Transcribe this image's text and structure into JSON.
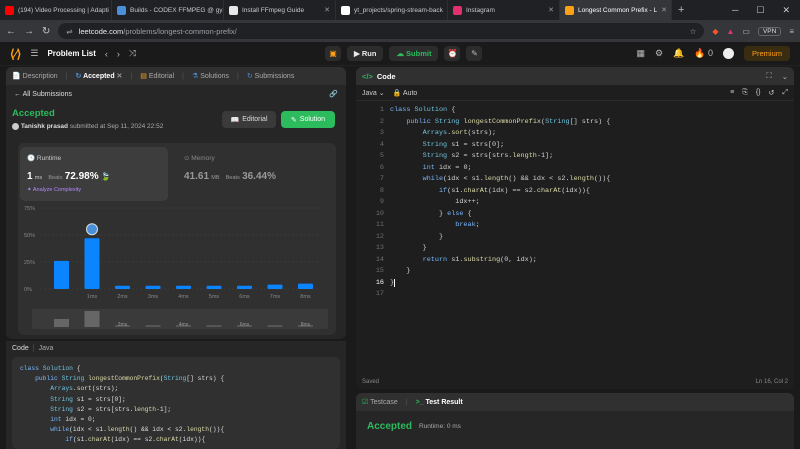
{
  "browser": {
    "tabs": [
      {
        "title": "(194) Video Processing | Adapti",
        "color": "#ff0000"
      },
      {
        "title": "Builds - CODEX FFMPEG @ gya",
        "color": "#4a90d9"
      },
      {
        "title": "Install FFmpeg Guide",
        "color": "#e8e8e8"
      },
      {
        "title": "yt_projects/spring-stream-back",
        "color": "#ffffff"
      },
      {
        "title": "Instagram",
        "color": "#e1306c"
      },
      {
        "title": "Longest Common Prefix - L",
        "color": "#ffa116"
      }
    ],
    "url_host": "leetcode.com",
    "url_path": "/problems/longest-common-prefix/",
    "vpn": "VPN"
  },
  "header": {
    "problem_list": "Problem List",
    "run": "Run",
    "submit": "Submit",
    "streak": "0",
    "premium": "Premium"
  },
  "left": {
    "tabs": [
      "Description",
      "Accepted",
      "Editorial",
      "Solutions",
      "Submissions"
    ],
    "all_submissions": "All Submissions",
    "status": "Accepted",
    "user": "Tanishk prasad",
    "submitted": "submitted at Sep 11, 2024 22:52",
    "editorial_btn": "Editorial",
    "solution_btn": "Solution",
    "runtime": {
      "label": "Runtime",
      "value": "1",
      "unit": "ms",
      "beats_label": "Beats",
      "beats": "72.98%"
    },
    "memory": {
      "label": "Memory",
      "value": "41.61",
      "unit": "MB",
      "beats_label": "Beats",
      "beats": "36.44%"
    },
    "analyze": "Analyze Complexity",
    "code_label": "Code",
    "lang": "Java"
  },
  "chart_data": {
    "type": "bar",
    "y_ticks": [
      "75%",
      "50%",
      "25%",
      "0%"
    ],
    "ylim": [
      0,
      75
    ],
    "categories": [
      "",
      "1ms",
      "2ms",
      "3ms",
      "4ms",
      "5ms",
      "6ms",
      "7ms",
      "8ms"
    ],
    "values": [
      26,
      47,
      3,
      3,
      3,
      3,
      3,
      4,
      5
    ],
    "highlight_index": 1,
    "mini_values": [
      8,
      16,
      2,
      2,
      2,
      2,
      2,
      2,
      2
    ],
    "mini_labels": [
      "",
      "",
      "2ms",
      "",
      "4ms",
      "",
      "6ms",
      "",
      "8ms"
    ]
  },
  "editor": {
    "title": "Code",
    "lang": "Java",
    "mode": "Auto",
    "lines": [
      "class Solution {",
      "    public String longestCommonPrefix(String[] strs) {",
      "        Arrays.sort(strs);",
      "        String s1 = strs[0];",
      "        String s2 = strs[strs.length-1];",
      "        int idx = 0;",
      "        while(idx < s1.length() && idx < s2.length()){",
      "            if(s1.charAt(idx) == s2.charAt(idx)){",
      "                idx++;",
      "            } else {",
      "                break;",
      "            }",
      "        }",
      "        return s1.substring(0, idx);",
      "    }",
      "}",
      ""
    ],
    "current_line": 16,
    "saved": "Saved",
    "position": "Ln 16, Col 2"
  },
  "left_code": [
    "class Solution {",
    "    public String longestCommonPrefix(String[] strs) {",
    "        Arrays.sort(strs);",
    "        String s1 = strs[0];",
    "        String s2 = strs[strs.length-1];",
    "        int idx = 0;",
    "        while(idx < s1.length() && idx < s2.length()){",
    "            if(s1.charAt(idx) == s2.charAt(idx)){"
  ],
  "test": {
    "tabs": [
      "Testcase",
      "Test Result"
    ],
    "status": "Accepted",
    "runtime": "Runtime: 0 ms"
  }
}
